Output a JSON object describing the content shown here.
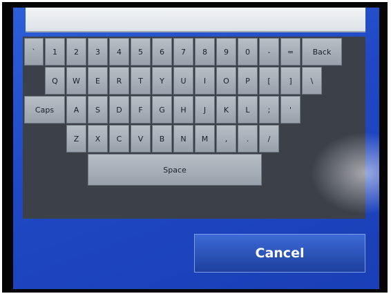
{
  "keyboard": {
    "row1": [
      "`",
      "1",
      "2",
      "3",
      "4",
      "5",
      "6",
      "7",
      "8",
      "9",
      "0",
      "-",
      "=",
      "Back"
    ],
    "row2": [
      "Q",
      "W",
      "E",
      "R",
      "T",
      "Y",
      "U",
      "I",
      "O",
      "P",
      "[",
      "]",
      "\\"
    ],
    "row3": [
      "Caps",
      "A",
      "S",
      "D",
      "F",
      "G",
      "H",
      "J",
      "K",
      "L",
      ";",
      "'"
    ],
    "row4": [
      "Z",
      "X",
      "C",
      "V",
      "B",
      "N",
      "M",
      ",",
      ".",
      "/"
    ],
    "space_label": "Space"
  },
  "cancel_label": "Cancel",
  "colors": {
    "screen_blue": "#2150cc",
    "key_gray": "#a9b1ba",
    "panel_dark": "#3b4049"
  }
}
